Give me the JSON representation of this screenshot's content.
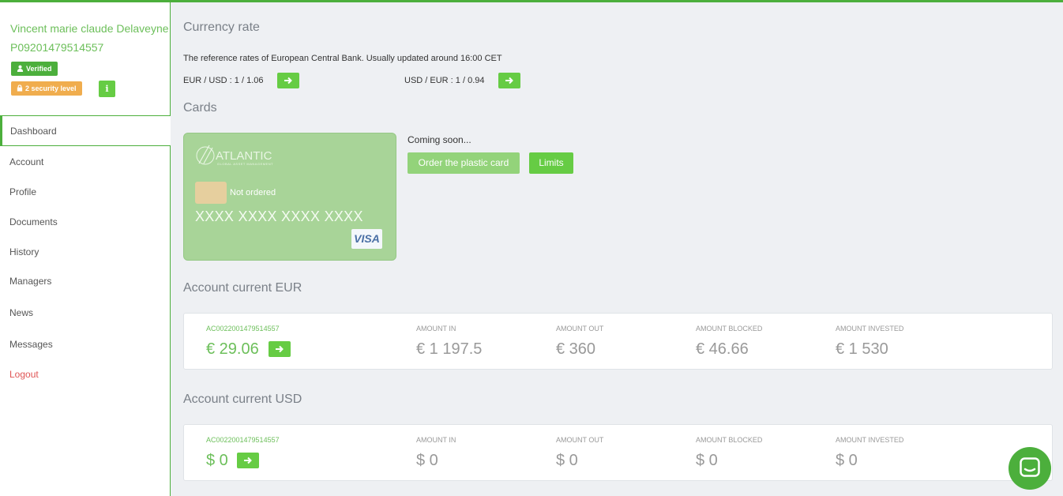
{
  "user": {
    "name": "Vincent marie claude Delaveyne",
    "id": "P09201479514557",
    "verified_label": "Verified",
    "security_label": "2 security level",
    "info_label": "i"
  },
  "nav": [
    {
      "label": "Dashboard",
      "active": true
    },
    {
      "label": "Account"
    },
    {
      "label": "Profile"
    },
    {
      "label": "Documents"
    },
    {
      "label": "History"
    },
    {
      "label": "Managers"
    },
    {
      "label": "News"
    },
    {
      "label": "Messages"
    },
    {
      "label": "Logout",
      "color": "#e05555"
    }
  ],
  "currency": {
    "title": "Currency rate",
    "description": "The reference rates of European Central Bank. Usually updated around 16:00 CET",
    "eur_usd": "EUR / USD : 1 / 1.06",
    "usd_eur": "USD / EUR : 1 / 0.94"
  },
  "cards": {
    "title": "Cards",
    "brand": "ATLANTIC",
    "brand_sub": "GLOBAL ASSET MANAGEMENT",
    "status": "Not ordered",
    "number": "XXXX XXXX XXXX XXXX",
    "network": "VISA",
    "coming_soon": "Coming soon...",
    "order_button": "Order the plastic card",
    "limits_button": "Limits"
  },
  "accounts": {
    "eur": {
      "title": "Account current EUR",
      "number": "AC0022001479514557",
      "balance": "€ 29.06",
      "amount_in_label": "AMOUNT IN",
      "amount_in": "€ 1 197.5",
      "amount_out_label": "AMOUNT OUT",
      "amount_out": "€ 360",
      "amount_blocked_label": "AMOUNT BLOCKED",
      "amount_blocked": "€ 46.66",
      "amount_invested_label": "AMOUNT INVESTED",
      "amount_invested": "€ 1 530"
    },
    "usd": {
      "title": "Account current USD",
      "number": "AC0022001479514557",
      "balance": "$ 0",
      "amount_in_label": "AMOUNT IN",
      "amount_in": "$ 0",
      "amount_out_label": "AMOUNT OUT",
      "amount_out": "$ 0",
      "amount_blocked_label": "AMOUNT BLOCKED",
      "amount_blocked": "$ 0",
      "amount_invested_label": "AMOUNT INVESTED",
      "amount_invested": "$ 0"
    }
  },
  "colors": {
    "accent": "#4caf3c",
    "button_green": "#66cc44",
    "security_orange": "#f0ad4e",
    "logout_red": "#e05555"
  },
  "icons": [
    "user-icon",
    "lock-icon",
    "info-icon",
    "arrow-right-icon",
    "chat-icon"
  ]
}
